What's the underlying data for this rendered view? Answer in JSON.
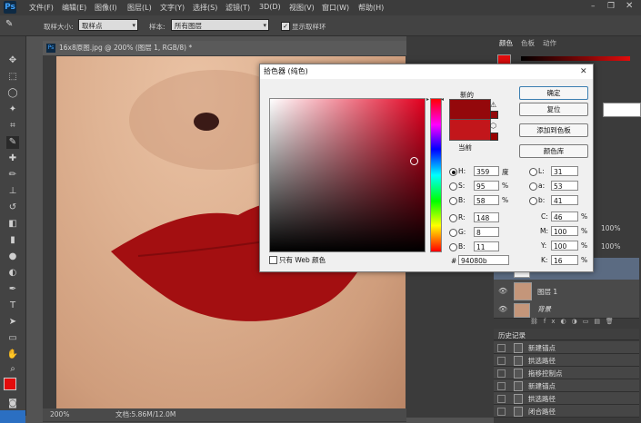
{
  "app": {
    "logo": "Ps"
  },
  "menu": [
    "文件(F)",
    "编辑(E)",
    "图像(I)",
    "图层(L)",
    "文字(Y)",
    "选择(S)",
    "滤镜(T)",
    "3D(D)",
    "视图(V)",
    "窗口(W)",
    "帮助(H)"
  ],
  "options": {
    "sample_size_label": "取样大小:",
    "sample_size_value": "取样点",
    "sample_label": "样本:",
    "sample_value": "所有图层",
    "show_ring_label": "显示取样环"
  },
  "document": {
    "title": "16x8原图.jpg @ 200% (图层 1, RGB/8) *",
    "zoom": "200%",
    "doc_info": "文档:5.86M/12.0M"
  },
  "panels": {
    "tabs": [
      "颜色",
      "色板",
      "动作"
    ],
    "layers_opacity": "100%",
    "layers_fill": "100%",
    "layer_name": "图层 1",
    "layer_bg_name": "背景",
    "history_tab": "历史记录",
    "history_items": [
      "新建锚点",
      "拱选路径",
      "拖移控制点",
      "新建锚点",
      "拱选路径",
      "闭合路径"
    ]
  },
  "picker": {
    "title": "拾色器 (纯色)",
    "new_label": "新的",
    "current_label": "当前",
    "new_color": "#94080b",
    "current_color": "#c2161b",
    "buttons": {
      "ok": "确定",
      "reset": "复位",
      "add_swatch": "添加到色板",
      "library": "颜色库"
    },
    "web_only_label": "只有 Web 颜色",
    "fields": {
      "H": {
        "value": "359",
        "unit": "度"
      },
      "S": {
        "value": "95",
        "unit": "%"
      },
      "B": {
        "value": "58",
        "unit": "%"
      },
      "R": {
        "value": "148"
      },
      "G": {
        "value": "8"
      },
      "Bc": {
        "label": "B:",
        "value": "11"
      },
      "L": {
        "value": "31"
      },
      "a": {
        "value": "53"
      },
      "b": {
        "value": "41"
      },
      "C": {
        "value": "46",
        "unit": "%"
      },
      "M": {
        "value": "100",
        "unit": "%"
      },
      "Y": {
        "value": "100",
        "unit": "%"
      },
      "K": {
        "value": "16",
        "unit": "%"
      }
    },
    "hex_label": "#",
    "hex_value": "94080b"
  },
  "colors": {
    "foreground": "#e20c0c",
    "background": "#000000",
    "lip": "#a30f11"
  }
}
